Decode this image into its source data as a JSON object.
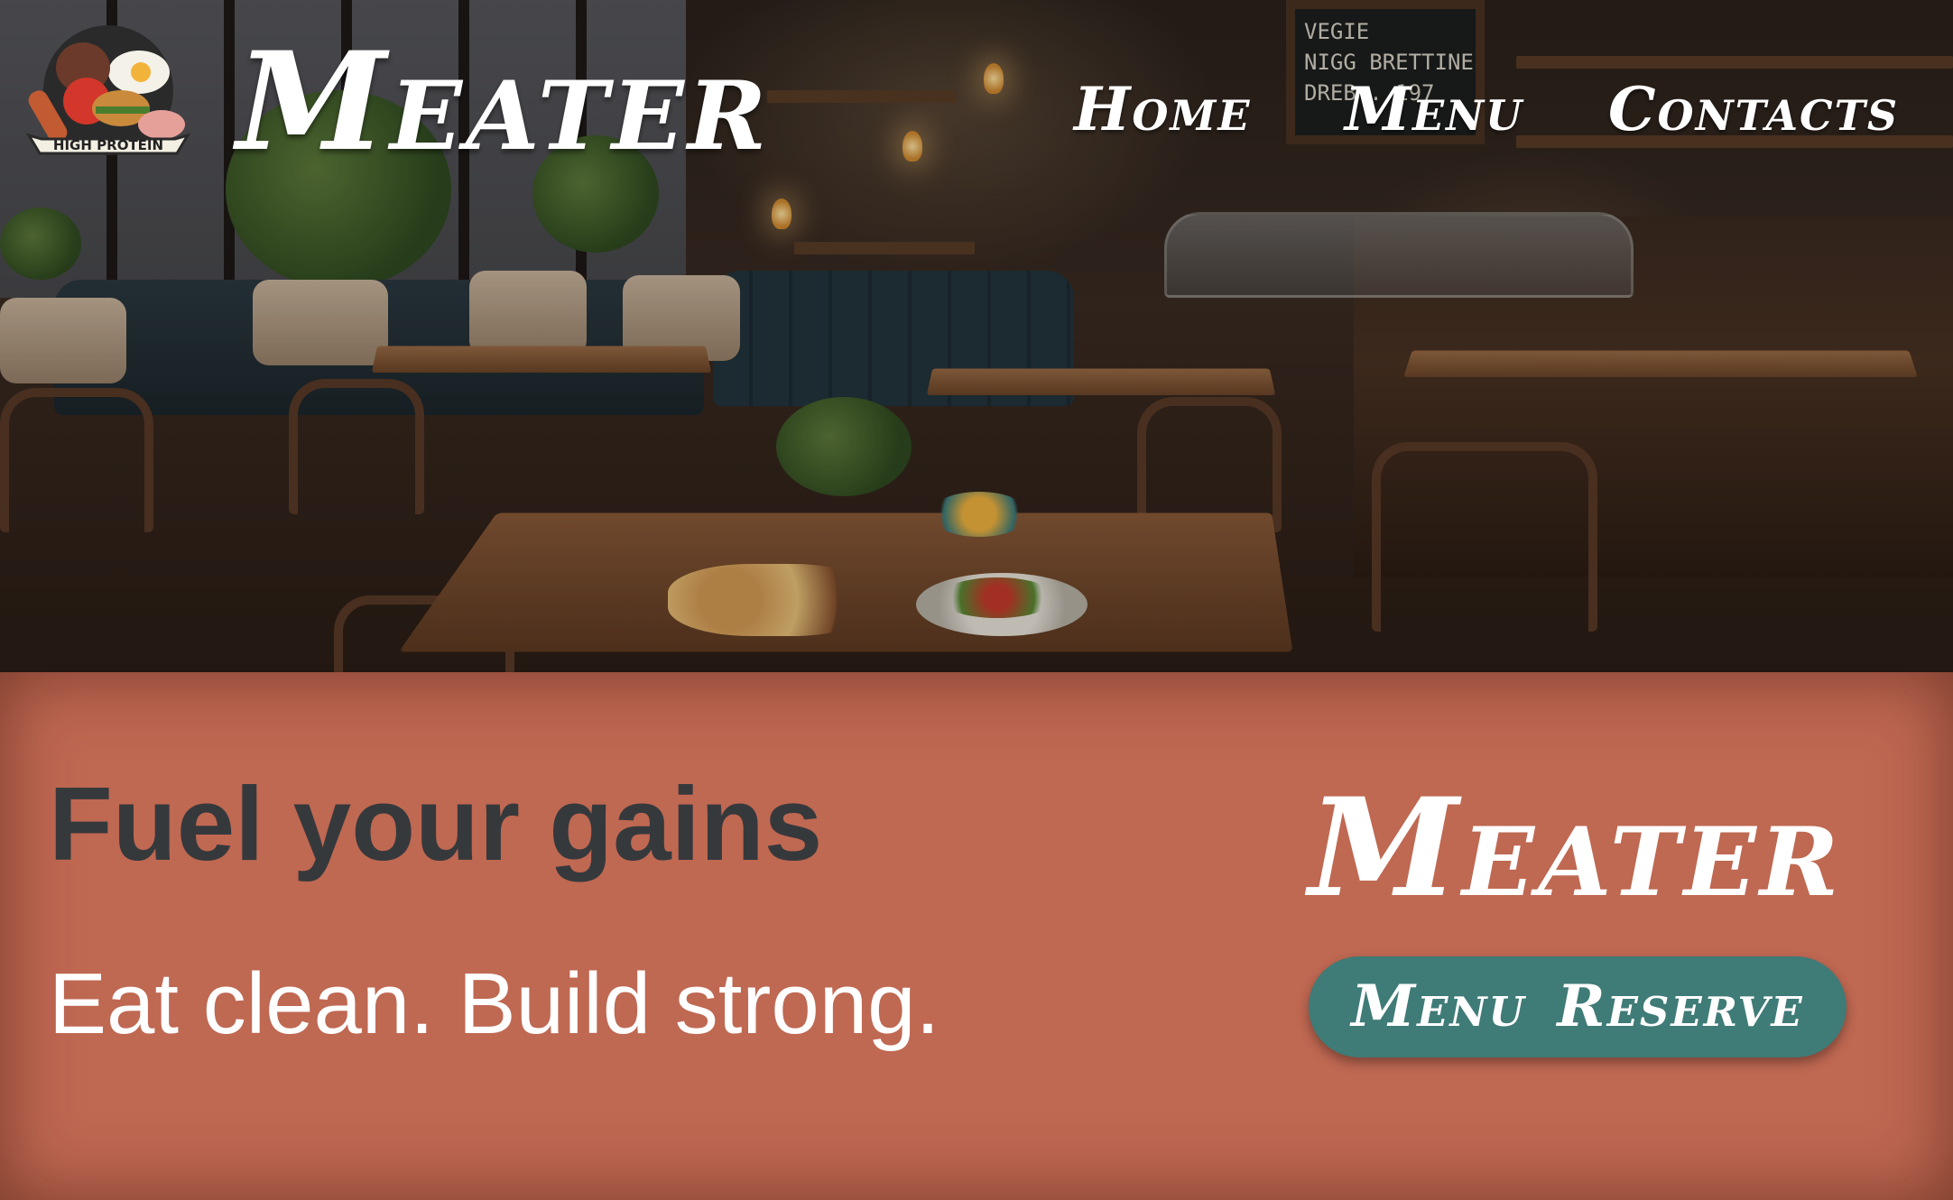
{
  "header": {
    "brand": "Meater",
    "logo": {
      "badge_text": "HIGH PROTEIN"
    },
    "nav": [
      {
        "label": "Home",
        "active": true
      },
      {
        "label": "Menu",
        "active": false
      },
      {
        "label": "Contacts",
        "active": false
      }
    ]
  },
  "hero": {
    "chalkboard_text": [
      "VEGIE",
      "NIGG BRETTINE",
      "DREB . 197"
    ]
  },
  "banner": {
    "headline": "Fuel your gains",
    "tagline": "Eat clean. Build strong.",
    "brand": "Meater",
    "buttons": {
      "menu": "Menu",
      "reserve": "Reserve"
    }
  },
  "colors": {
    "banner_bg": "#bf6852",
    "headline": "#36393c",
    "pill_bg": "#3f7b77",
    "active_nav_brush": "#4b9a3f",
    "text_light": "#ffffff"
  }
}
